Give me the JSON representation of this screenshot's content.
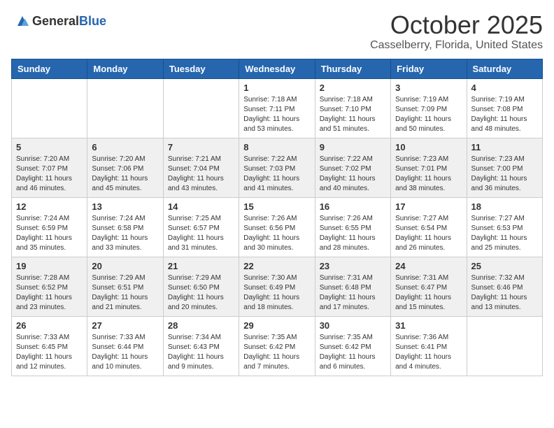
{
  "header": {
    "logo_general": "General",
    "logo_blue": "Blue",
    "month": "October 2025",
    "location": "Casselberry, Florida, United States"
  },
  "days_of_week": [
    "Sunday",
    "Monday",
    "Tuesday",
    "Wednesday",
    "Thursday",
    "Friday",
    "Saturday"
  ],
  "weeks": [
    [
      {
        "day": "",
        "info": ""
      },
      {
        "day": "",
        "info": ""
      },
      {
        "day": "",
        "info": ""
      },
      {
        "day": "1",
        "info": "Sunrise: 7:18 AM\nSunset: 7:11 PM\nDaylight: 11 hours and 53 minutes."
      },
      {
        "day": "2",
        "info": "Sunrise: 7:18 AM\nSunset: 7:10 PM\nDaylight: 11 hours and 51 minutes."
      },
      {
        "day": "3",
        "info": "Sunrise: 7:19 AM\nSunset: 7:09 PM\nDaylight: 11 hours and 50 minutes."
      },
      {
        "day": "4",
        "info": "Sunrise: 7:19 AM\nSunset: 7:08 PM\nDaylight: 11 hours and 48 minutes."
      }
    ],
    [
      {
        "day": "5",
        "info": "Sunrise: 7:20 AM\nSunset: 7:07 PM\nDaylight: 11 hours and 46 minutes."
      },
      {
        "day": "6",
        "info": "Sunrise: 7:20 AM\nSunset: 7:06 PM\nDaylight: 11 hours and 45 minutes."
      },
      {
        "day": "7",
        "info": "Sunrise: 7:21 AM\nSunset: 7:04 PM\nDaylight: 11 hours and 43 minutes."
      },
      {
        "day": "8",
        "info": "Sunrise: 7:22 AM\nSunset: 7:03 PM\nDaylight: 11 hours and 41 minutes."
      },
      {
        "day": "9",
        "info": "Sunrise: 7:22 AM\nSunset: 7:02 PM\nDaylight: 11 hours and 40 minutes."
      },
      {
        "day": "10",
        "info": "Sunrise: 7:23 AM\nSunset: 7:01 PM\nDaylight: 11 hours and 38 minutes."
      },
      {
        "day": "11",
        "info": "Sunrise: 7:23 AM\nSunset: 7:00 PM\nDaylight: 11 hours and 36 minutes."
      }
    ],
    [
      {
        "day": "12",
        "info": "Sunrise: 7:24 AM\nSunset: 6:59 PM\nDaylight: 11 hours and 35 minutes."
      },
      {
        "day": "13",
        "info": "Sunrise: 7:24 AM\nSunset: 6:58 PM\nDaylight: 11 hours and 33 minutes."
      },
      {
        "day": "14",
        "info": "Sunrise: 7:25 AM\nSunset: 6:57 PM\nDaylight: 11 hours and 31 minutes."
      },
      {
        "day": "15",
        "info": "Sunrise: 7:26 AM\nSunset: 6:56 PM\nDaylight: 11 hours and 30 minutes."
      },
      {
        "day": "16",
        "info": "Sunrise: 7:26 AM\nSunset: 6:55 PM\nDaylight: 11 hours and 28 minutes."
      },
      {
        "day": "17",
        "info": "Sunrise: 7:27 AM\nSunset: 6:54 PM\nDaylight: 11 hours and 26 minutes."
      },
      {
        "day": "18",
        "info": "Sunrise: 7:27 AM\nSunset: 6:53 PM\nDaylight: 11 hours and 25 minutes."
      }
    ],
    [
      {
        "day": "19",
        "info": "Sunrise: 7:28 AM\nSunset: 6:52 PM\nDaylight: 11 hours and 23 minutes."
      },
      {
        "day": "20",
        "info": "Sunrise: 7:29 AM\nSunset: 6:51 PM\nDaylight: 11 hours and 21 minutes."
      },
      {
        "day": "21",
        "info": "Sunrise: 7:29 AM\nSunset: 6:50 PM\nDaylight: 11 hours and 20 minutes."
      },
      {
        "day": "22",
        "info": "Sunrise: 7:30 AM\nSunset: 6:49 PM\nDaylight: 11 hours and 18 minutes."
      },
      {
        "day": "23",
        "info": "Sunrise: 7:31 AM\nSunset: 6:48 PM\nDaylight: 11 hours and 17 minutes."
      },
      {
        "day": "24",
        "info": "Sunrise: 7:31 AM\nSunset: 6:47 PM\nDaylight: 11 hours and 15 minutes."
      },
      {
        "day": "25",
        "info": "Sunrise: 7:32 AM\nSunset: 6:46 PM\nDaylight: 11 hours and 13 minutes."
      }
    ],
    [
      {
        "day": "26",
        "info": "Sunrise: 7:33 AM\nSunset: 6:45 PM\nDaylight: 11 hours and 12 minutes."
      },
      {
        "day": "27",
        "info": "Sunrise: 7:33 AM\nSunset: 6:44 PM\nDaylight: 11 hours and 10 minutes."
      },
      {
        "day": "28",
        "info": "Sunrise: 7:34 AM\nSunset: 6:43 PM\nDaylight: 11 hours and 9 minutes."
      },
      {
        "day": "29",
        "info": "Sunrise: 7:35 AM\nSunset: 6:42 PM\nDaylight: 11 hours and 7 minutes."
      },
      {
        "day": "30",
        "info": "Sunrise: 7:35 AM\nSunset: 6:42 PM\nDaylight: 11 hours and 6 minutes."
      },
      {
        "day": "31",
        "info": "Sunrise: 7:36 AM\nSunset: 6:41 PM\nDaylight: 11 hours and 4 minutes."
      },
      {
        "day": "",
        "info": ""
      }
    ]
  ]
}
